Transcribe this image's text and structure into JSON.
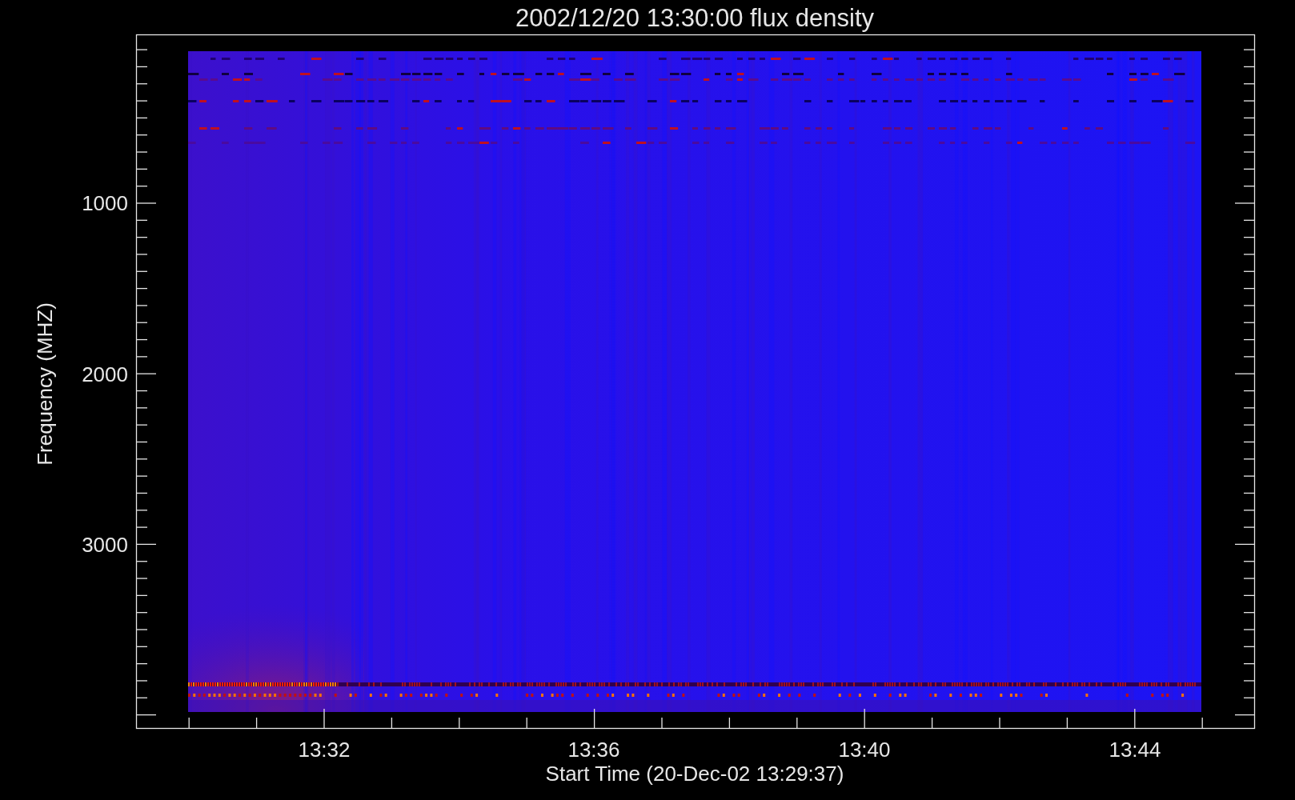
{
  "title": "2002/12/20 13:30:00 flux density",
  "y_axis": {
    "title": "Frequency (MHZ)",
    "tick_labels": [
      "1000",
      "2000",
      "3000"
    ]
  },
  "x_axis": {
    "title": "Start Time (20-Dec-02 13:29:37)",
    "tick_labels": [
      "13:32",
      "13:36",
      "13:40",
      "13:44"
    ]
  }
}
